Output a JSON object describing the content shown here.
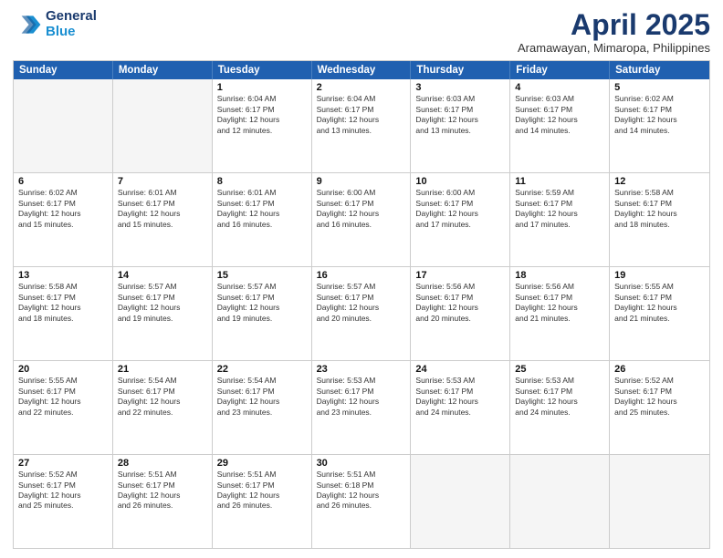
{
  "header": {
    "logo_line1": "General",
    "logo_line2": "Blue",
    "title": "April 2025",
    "subtitle": "Aramawayan, Mimaropa, Philippines"
  },
  "weekdays": [
    "Sunday",
    "Monday",
    "Tuesday",
    "Wednesday",
    "Thursday",
    "Friday",
    "Saturday"
  ],
  "weeks": [
    [
      {
        "day": "",
        "lines": [],
        "empty": true
      },
      {
        "day": "",
        "lines": [],
        "empty": true
      },
      {
        "day": "1",
        "lines": [
          "Sunrise: 6:04 AM",
          "Sunset: 6:17 PM",
          "Daylight: 12 hours",
          "and 12 minutes."
        ],
        "empty": false
      },
      {
        "day": "2",
        "lines": [
          "Sunrise: 6:04 AM",
          "Sunset: 6:17 PM",
          "Daylight: 12 hours",
          "and 13 minutes."
        ],
        "empty": false
      },
      {
        "day": "3",
        "lines": [
          "Sunrise: 6:03 AM",
          "Sunset: 6:17 PM",
          "Daylight: 12 hours",
          "and 13 minutes."
        ],
        "empty": false
      },
      {
        "day": "4",
        "lines": [
          "Sunrise: 6:03 AM",
          "Sunset: 6:17 PM",
          "Daylight: 12 hours",
          "and 14 minutes."
        ],
        "empty": false
      },
      {
        "day": "5",
        "lines": [
          "Sunrise: 6:02 AM",
          "Sunset: 6:17 PM",
          "Daylight: 12 hours",
          "and 14 minutes."
        ],
        "empty": false
      }
    ],
    [
      {
        "day": "6",
        "lines": [
          "Sunrise: 6:02 AM",
          "Sunset: 6:17 PM",
          "Daylight: 12 hours",
          "and 15 minutes."
        ],
        "empty": false
      },
      {
        "day": "7",
        "lines": [
          "Sunrise: 6:01 AM",
          "Sunset: 6:17 PM",
          "Daylight: 12 hours",
          "and 15 minutes."
        ],
        "empty": false
      },
      {
        "day": "8",
        "lines": [
          "Sunrise: 6:01 AM",
          "Sunset: 6:17 PM",
          "Daylight: 12 hours",
          "and 16 minutes."
        ],
        "empty": false
      },
      {
        "day": "9",
        "lines": [
          "Sunrise: 6:00 AM",
          "Sunset: 6:17 PM",
          "Daylight: 12 hours",
          "and 16 minutes."
        ],
        "empty": false
      },
      {
        "day": "10",
        "lines": [
          "Sunrise: 6:00 AM",
          "Sunset: 6:17 PM",
          "Daylight: 12 hours",
          "and 17 minutes."
        ],
        "empty": false
      },
      {
        "day": "11",
        "lines": [
          "Sunrise: 5:59 AM",
          "Sunset: 6:17 PM",
          "Daylight: 12 hours",
          "and 17 minutes."
        ],
        "empty": false
      },
      {
        "day": "12",
        "lines": [
          "Sunrise: 5:58 AM",
          "Sunset: 6:17 PM",
          "Daylight: 12 hours",
          "and 18 minutes."
        ],
        "empty": false
      }
    ],
    [
      {
        "day": "13",
        "lines": [
          "Sunrise: 5:58 AM",
          "Sunset: 6:17 PM",
          "Daylight: 12 hours",
          "and 18 minutes."
        ],
        "empty": false
      },
      {
        "day": "14",
        "lines": [
          "Sunrise: 5:57 AM",
          "Sunset: 6:17 PM",
          "Daylight: 12 hours",
          "and 19 minutes."
        ],
        "empty": false
      },
      {
        "day": "15",
        "lines": [
          "Sunrise: 5:57 AM",
          "Sunset: 6:17 PM",
          "Daylight: 12 hours",
          "and 19 minutes."
        ],
        "empty": false
      },
      {
        "day": "16",
        "lines": [
          "Sunrise: 5:57 AM",
          "Sunset: 6:17 PM",
          "Daylight: 12 hours",
          "and 20 minutes."
        ],
        "empty": false
      },
      {
        "day": "17",
        "lines": [
          "Sunrise: 5:56 AM",
          "Sunset: 6:17 PM",
          "Daylight: 12 hours",
          "and 20 minutes."
        ],
        "empty": false
      },
      {
        "day": "18",
        "lines": [
          "Sunrise: 5:56 AM",
          "Sunset: 6:17 PM",
          "Daylight: 12 hours",
          "and 21 minutes."
        ],
        "empty": false
      },
      {
        "day": "19",
        "lines": [
          "Sunrise: 5:55 AM",
          "Sunset: 6:17 PM",
          "Daylight: 12 hours",
          "and 21 minutes."
        ],
        "empty": false
      }
    ],
    [
      {
        "day": "20",
        "lines": [
          "Sunrise: 5:55 AM",
          "Sunset: 6:17 PM",
          "Daylight: 12 hours",
          "and 22 minutes."
        ],
        "empty": false
      },
      {
        "day": "21",
        "lines": [
          "Sunrise: 5:54 AM",
          "Sunset: 6:17 PM",
          "Daylight: 12 hours",
          "and 22 minutes."
        ],
        "empty": false
      },
      {
        "day": "22",
        "lines": [
          "Sunrise: 5:54 AM",
          "Sunset: 6:17 PM",
          "Daylight: 12 hours",
          "and 23 minutes."
        ],
        "empty": false
      },
      {
        "day": "23",
        "lines": [
          "Sunrise: 5:53 AM",
          "Sunset: 6:17 PM",
          "Daylight: 12 hours",
          "and 23 minutes."
        ],
        "empty": false
      },
      {
        "day": "24",
        "lines": [
          "Sunrise: 5:53 AM",
          "Sunset: 6:17 PM",
          "Daylight: 12 hours",
          "and 24 minutes."
        ],
        "empty": false
      },
      {
        "day": "25",
        "lines": [
          "Sunrise: 5:53 AM",
          "Sunset: 6:17 PM",
          "Daylight: 12 hours",
          "and 24 minutes."
        ],
        "empty": false
      },
      {
        "day": "26",
        "lines": [
          "Sunrise: 5:52 AM",
          "Sunset: 6:17 PM",
          "Daylight: 12 hours",
          "and 25 minutes."
        ],
        "empty": false
      }
    ],
    [
      {
        "day": "27",
        "lines": [
          "Sunrise: 5:52 AM",
          "Sunset: 6:17 PM",
          "Daylight: 12 hours",
          "and 25 minutes."
        ],
        "empty": false
      },
      {
        "day": "28",
        "lines": [
          "Sunrise: 5:51 AM",
          "Sunset: 6:17 PM",
          "Daylight: 12 hours",
          "and 26 minutes."
        ],
        "empty": false
      },
      {
        "day": "29",
        "lines": [
          "Sunrise: 5:51 AM",
          "Sunset: 6:17 PM",
          "Daylight: 12 hours",
          "and 26 minutes."
        ],
        "empty": false
      },
      {
        "day": "30",
        "lines": [
          "Sunrise: 5:51 AM",
          "Sunset: 6:18 PM",
          "Daylight: 12 hours",
          "and 26 minutes."
        ],
        "empty": false
      },
      {
        "day": "",
        "lines": [],
        "empty": true
      },
      {
        "day": "",
        "lines": [],
        "empty": true
      },
      {
        "day": "",
        "lines": [],
        "empty": true
      }
    ]
  ]
}
